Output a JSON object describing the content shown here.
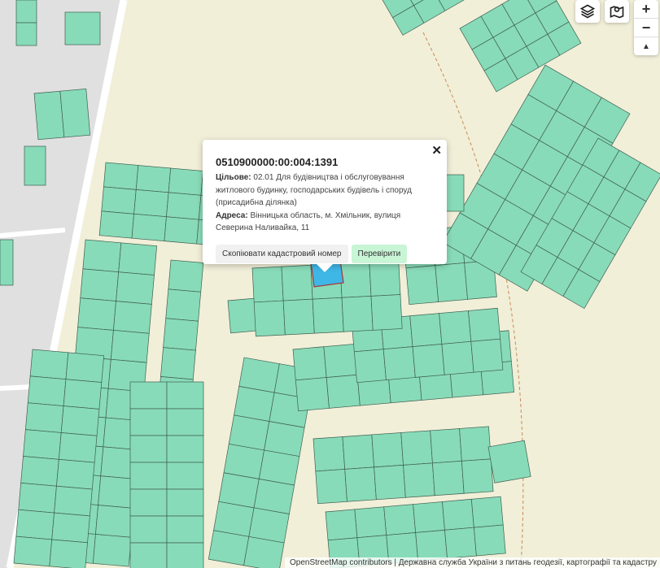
{
  "popup": {
    "cadastral_number": "0510900000:00:004:1391",
    "purpose_label": "Цільове:",
    "purpose_value": "02.01 Для будівництва і обслуговування житлового будинку, господарських будівель і споруд (присадибна ділянка)",
    "address_label": "Адреса:",
    "address_value": "Вінницька область, м. Хмільник, вулиця Северина Наливайка, 11",
    "copy_button": "Скопіювати кадастровий номер",
    "check_button": "Перевірити",
    "close_symbol": "✕"
  },
  "controls": {
    "layers_icon": "layers-icon",
    "map_icon": "map-pin-icon",
    "zoom_in": "+",
    "zoom_out": "−",
    "north": "▲"
  },
  "attribution": {
    "osm_link": "OpenStreetMap contributors",
    "separator": " | ",
    "source": "Державна служба України з питань геодезії, картографії та кадастру"
  },
  "colors": {
    "parcel": "#88dbb8",
    "selected": "#3eb6e6",
    "background": "#f1efd8"
  }
}
